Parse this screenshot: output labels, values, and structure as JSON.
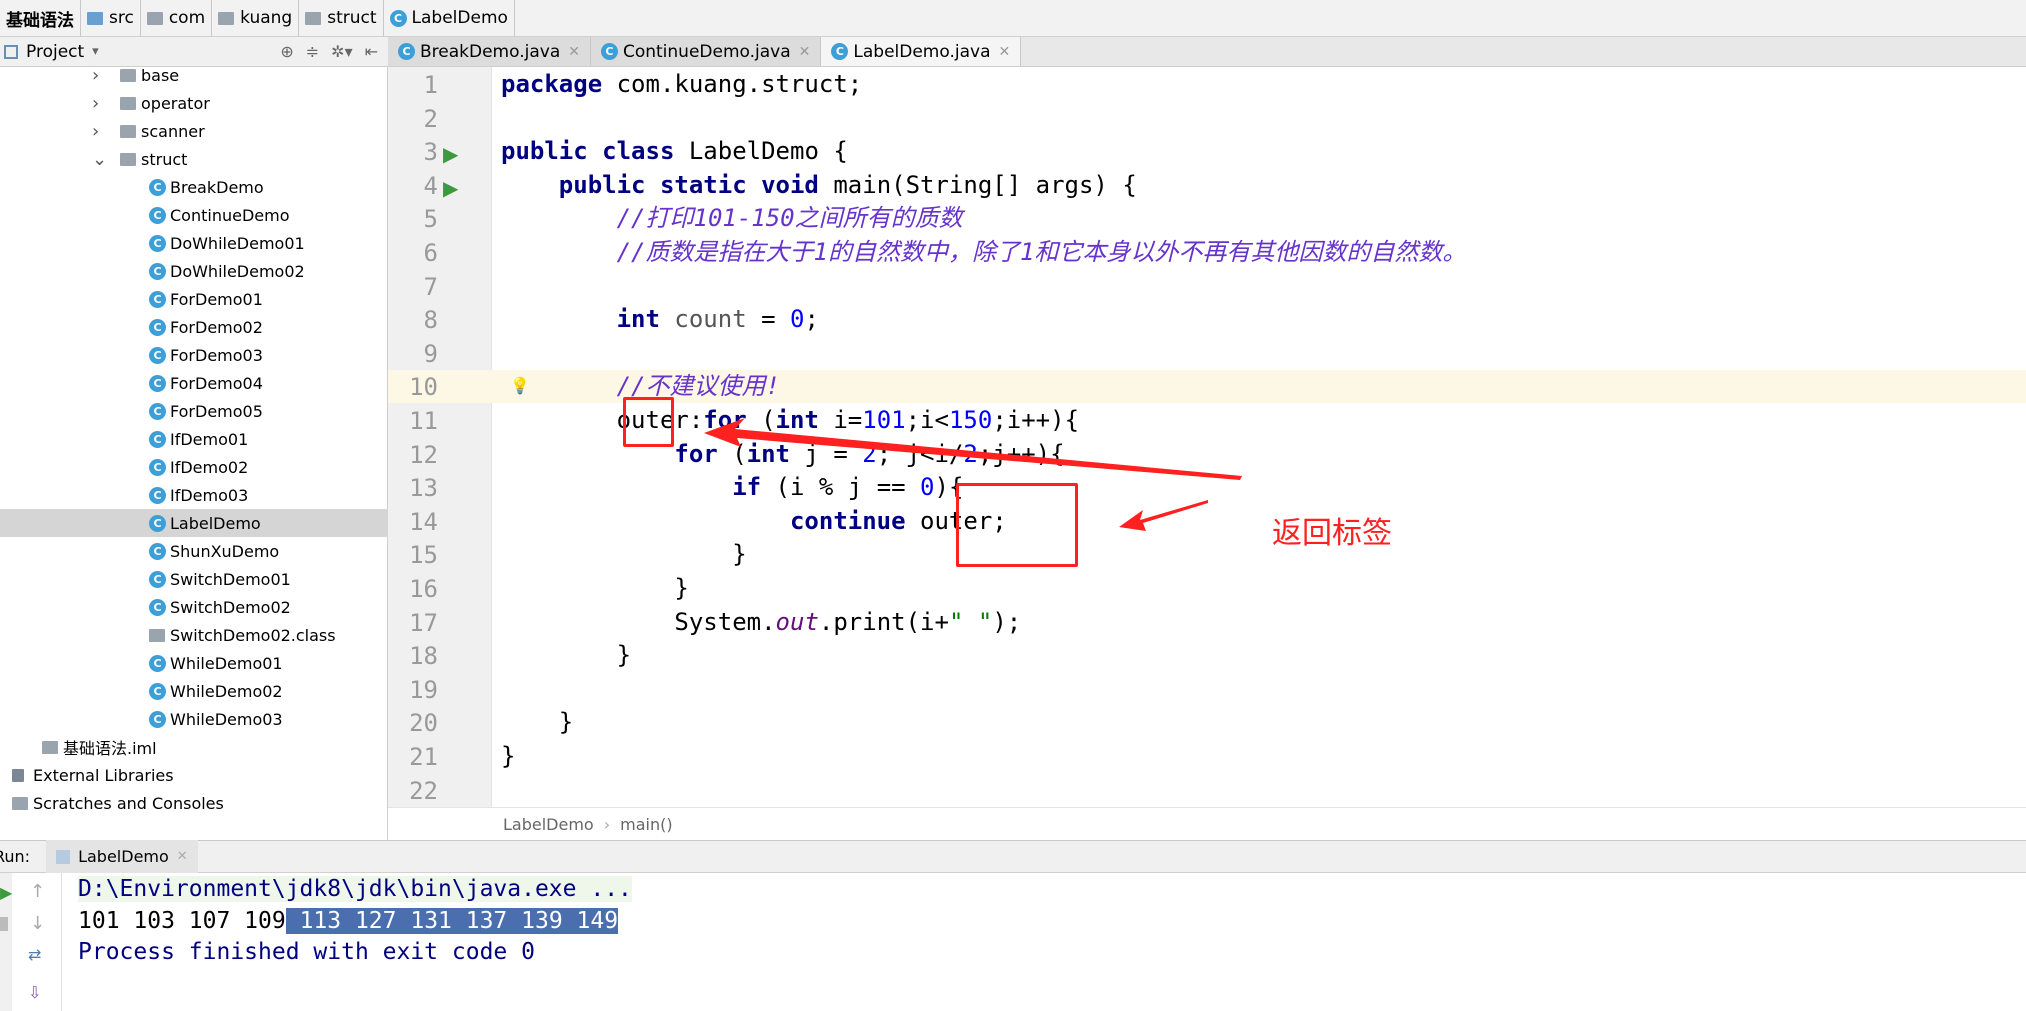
{
  "breadcrumb": [
    "基础语法",
    "src",
    "com",
    "kuang",
    "struct",
    "LabelDemo"
  ],
  "project": {
    "title": "Project",
    "dropdown": "▾"
  },
  "tabs": [
    {
      "label": "BreakDemo.java"
    },
    {
      "label": "ContinueDemo.java"
    },
    {
      "label": "LabelDemo.java",
      "active": true
    }
  ],
  "tree": [
    {
      "label": "base",
      "type": "folder",
      "depth": 1,
      "collapsed": true
    },
    {
      "label": "operator",
      "type": "folder",
      "depth": 1,
      "collapsed": true
    },
    {
      "label": "scanner",
      "type": "folder",
      "depth": 1,
      "collapsed": true
    },
    {
      "label": "struct",
      "type": "folder",
      "depth": 1,
      "expanded": true
    },
    {
      "label": "BreakDemo",
      "type": "class",
      "depth": 2
    },
    {
      "label": "ContinueDemo",
      "type": "class",
      "depth": 2
    },
    {
      "label": "DoWhileDemo01",
      "type": "class",
      "depth": 2
    },
    {
      "label": "DoWhileDemo02",
      "type": "class",
      "depth": 2
    },
    {
      "label": "ForDemo01",
      "type": "class",
      "depth": 2
    },
    {
      "label": "ForDemo02",
      "type": "class",
      "depth": 2
    },
    {
      "label": "ForDemo03",
      "type": "class",
      "depth": 2
    },
    {
      "label": "ForDemo04",
      "type": "class",
      "depth": 2
    },
    {
      "label": "ForDemo05",
      "type": "class",
      "depth": 2
    },
    {
      "label": "IfDemo01",
      "type": "class",
      "depth": 2
    },
    {
      "label": "IfDemo02",
      "type": "class",
      "depth": 2
    },
    {
      "label": "IfDemo03",
      "type": "class",
      "depth": 2
    },
    {
      "label": "LabelDemo",
      "type": "class",
      "depth": 2,
      "selected": true
    },
    {
      "label": "ShunXuDemo",
      "type": "class",
      "depth": 2
    },
    {
      "label": "SwitchDemo01",
      "type": "class",
      "depth": 2
    },
    {
      "label": "SwitchDemo02",
      "type": "class",
      "depth": 2
    },
    {
      "label": "SwitchDemo02.class",
      "type": "binary",
      "depth": 2
    },
    {
      "label": "WhileDemo01",
      "type": "class",
      "depth": 2
    },
    {
      "label": "WhileDemo02",
      "type": "class",
      "depth": 2
    },
    {
      "label": "WhileDemo03",
      "type": "class",
      "depth": 2
    },
    {
      "label": "基础语法.iml",
      "type": "iml",
      "depth": 0
    },
    {
      "label": "External Libraries",
      "type": "lib",
      "depth": -1
    },
    {
      "label": "Scratches and Consoles",
      "type": "scratch",
      "depth": -1
    }
  ],
  "code": [
    [
      [
        "package ",
        "kw"
      ],
      [
        "com.kuang.struct;",
        ""
      ]
    ],
    [],
    [
      [
        "public class ",
        "kw"
      ],
      [
        "LabelDemo {",
        ""
      ]
    ],
    [
      [
        "    public static void ",
        "kw"
      ],
      [
        "main(String[] args) {",
        ""
      ]
    ],
    [
      [
        "        //打印101-150之间所有的质数",
        "cm"
      ]
    ],
    [
      [
        "        //质数是指在大于1的自然数中，除了1和它本身以外不再有其他因数的自然数。",
        "cm"
      ]
    ],
    [],
    [
      [
        "        int ",
        "kw"
      ],
      [
        "count",
        "var"
      ],
      [
        " = ",
        ""
      ],
      [
        "0",
        "num"
      ],
      [
        ";",
        ""
      ]
    ],
    [],
    [
      [
        "        //不建议使用!",
        "cm"
      ]
    ],
    [
      [
        "        outer:",
        ""
      ],
      [
        "for ",
        "kw"
      ],
      [
        "(",
        ""
      ],
      [
        "int ",
        "kw"
      ],
      [
        "i=",
        ""
      ],
      [
        "101",
        "num"
      ],
      [
        ";i<",
        ""
      ],
      [
        "150",
        "num"
      ],
      [
        ";i++){",
        ""
      ]
    ],
    [
      [
        "            for ",
        "kw"
      ],
      [
        "(",
        ""
      ],
      [
        "int ",
        "kw"
      ],
      [
        "j = ",
        ""
      ],
      [
        "2",
        "num"
      ],
      [
        "; j<i/",
        ""
      ],
      [
        "2",
        "num"
      ],
      [
        ";j++){",
        ""
      ]
    ],
    [
      [
        "                if ",
        "kw"
      ],
      [
        "(i % j == ",
        ""
      ],
      [
        "0",
        "num"
      ],
      [
        "){",
        ""
      ]
    ],
    [
      [
        "                    continue ",
        "kw"
      ],
      [
        "outer;",
        ""
      ]
    ],
    [
      [
        "                }",
        ""
      ]
    ],
    [
      [
        "            }",
        ""
      ]
    ],
    [
      [
        "            System.",
        ""
      ],
      [
        "out",
        "fld"
      ],
      [
        ".print(i+",
        ""
      ],
      [
        "\" \"",
        "str"
      ],
      [
        ");",
        ""
      ]
    ],
    [
      [
        "        }",
        ""
      ]
    ],
    [],
    [
      [
        "    }",
        ""
      ]
    ],
    [
      [
        "}",
        ""
      ]
    ],
    []
  ],
  "highlighted_line": 10,
  "run_lines": [
    3,
    4
  ],
  "editor_breadcrumb": [
    "LabelDemo",
    "main()"
  ],
  "run": {
    "label": "Run:",
    "tab": "LabelDemo"
  },
  "console": {
    "cmd": "D:\\Environment\\jdk8\\jdk\\bin\\java.exe ...",
    "out_plain": "101 103 107 109",
    "out_selected": " 113 127 131 137 139 149",
    "exit": "Process finished with exit code 0"
  },
  "annotation": {
    "text": "返回标签",
    "color": "#ff2020"
  }
}
